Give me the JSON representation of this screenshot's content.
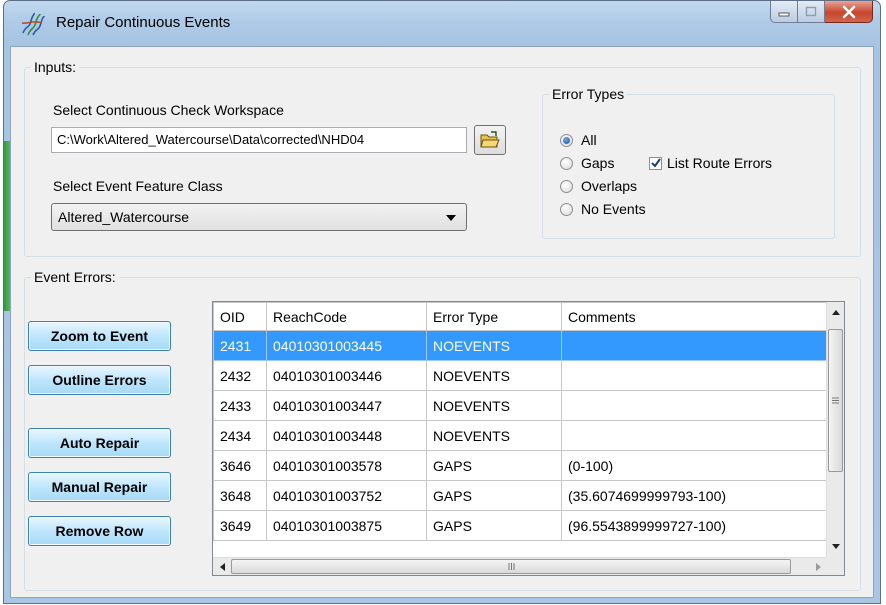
{
  "window": {
    "title": "Repair Continuous Events",
    "icon": "squiggle-app-icon",
    "controls": [
      "minimize-icon",
      "maximize-icon",
      "close-icon"
    ]
  },
  "inputs": {
    "legend": "Inputs:",
    "workspace_label": "Select Continuous Check Workspace",
    "workspace_value": "C:\\Work\\Altered_Watercourse\\Data\\corrected\\NHD04",
    "browse_icon": "open-folder-icon",
    "feature_class_label": "Select Event Feature Class",
    "feature_class_value": "Altered_Watercourse"
  },
  "error_types": {
    "legend": "Error Types",
    "options": [
      {
        "label": "All",
        "selected": true
      },
      {
        "label": "Gaps",
        "selected": false
      },
      {
        "label": "Overlaps",
        "selected": false
      },
      {
        "label": "No Events",
        "selected": false
      }
    ],
    "list_route_errors": {
      "label": "List Route Errors",
      "checked": true
    }
  },
  "event_errors": {
    "legend": "Event Errors:",
    "buttons": {
      "zoom": "Zoom to Event",
      "outline": "Outline Errors",
      "auto_repair": "Auto Repair",
      "manual_repair": "Manual Repair",
      "remove_row": "Remove Row"
    },
    "columns": [
      "OID",
      "ReachCode",
      "Error Type",
      "Comments"
    ],
    "rows": [
      [
        "2431",
        "04010301003445",
        "NOEVENTS",
        ""
      ],
      [
        "2432",
        "04010301003446",
        "NOEVENTS",
        ""
      ],
      [
        "2433",
        "04010301003447",
        "NOEVENTS",
        ""
      ],
      [
        "2434",
        "04010301003448",
        "NOEVENTS",
        ""
      ],
      [
        "3646",
        "04010301003578",
        "GAPS",
        "(0-100)"
      ],
      [
        "3648",
        "04010301003752",
        "GAPS",
        "(35.6074699999793-100)"
      ],
      [
        "3649",
        "04010301003875",
        "GAPS",
        "(96.5543899999727-100)"
      ]
    ],
    "selected_row": 0
  },
  "colors": {
    "selection": "#3399ff",
    "button_border": "#3c7fb1",
    "window_frame": "#a9c6e4"
  }
}
